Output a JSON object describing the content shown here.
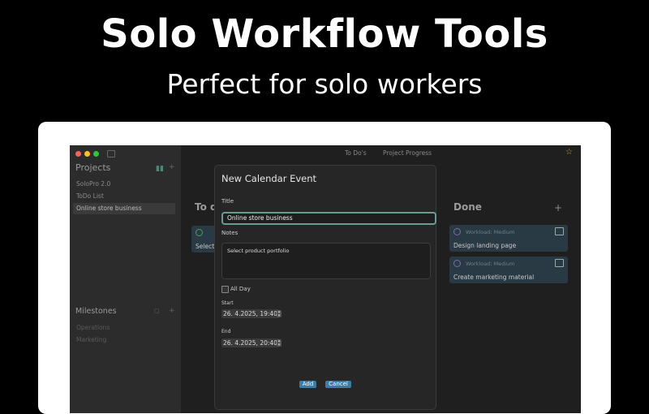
{
  "headline": "Solo Workflow Tools",
  "subheadline": "Perfect for solo workers",
  "window": {
    "traffic_colors": [
      "#ff5f57",
      "#febc2e",
      "#28c840"
    ],
    "tabs": [
      "To Do's",
      "Project Progress"
    ]
  },
  "sidebar": {
    "projects_title": "Projects",
    "projects": [
      "SoloPro 2.0",
      "ToDo List",
      "Online store business"
    ],
    "selected_project": "Online store business",
    "milestones_title": "Milestones",
    "milestones": [
      "Operations",
      "Marketing"
    ]
  },
  "board": {
    "todo_title_partial": "To d",
    "todo_card_partial": "Select",
    "done_title": "Done",
    "add_symbol": "+",
    "done_cards": [
      {
        "meta": "Workload: Medium",
        "text": "Design landing page"
      },
      {
        "meta": "Workload: Medium",
        "text": "Create marketing material"
      }
    ]
  },
  "dialog": {
    "title": "New Calendar Event",
    "title_label": "Title",
    "title_value": "Online store business",
    "notes_label": "Notes",
    "notes_value": "Select product portfolio",
    "all_day_label": "All Day",
    "start_label": "Start",
    "start_value": "26.  4.2025, 19:40",
    "end_label": "End",
    "end_value": "26.  4.2025, 20:40",
    "add_button": "Add",
    "cancel_button": "Cancel"
  },
  "colors": {
    "background": "#000000",
    "accent_button": "#3b7ca8",
    "focus_ring": "#6a9a94"
  }
}
